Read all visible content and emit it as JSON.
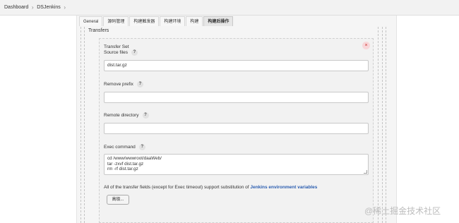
{
  "breadcrumb": {
    "items": [
      "Dashboard",
      "DSJenkins"
    ],
    "separator": "›"
  },
  "tabs": [
    {
      "label": "General",
      "active": false
    },
    {
      "label": "源码管理",
      "active": false
    },
    {
      "label": "构建触发器",
      "active": false
    },
    {
      "label": "构建环境",
      "active": false
    },
    {
      "label": "构建",
      "active": false
    },
    {
      "label": "构建后操作",
      "active": true
    }
  ],
  "transfers": {
    "label": "Transfers",
    "set_title": "Transfer Set",
    "close_symbol": "×"
  },
  "fields": {
    "source_files": {
      "label": "Source files",
      "value": "dist.tar.gz"
    },
    "remove_prefix": {
      "label": "Remove prefix",
      "value": ""
    },
    "remote_directory": {
      "label": "Remote directory",
      "value": ""
    },
    "exec_command": {
      "label": "Exec command",
      "lines": [
        "cd /www/wwwroot/daaWeb/",
        "tar -zxvf dist.tar.gz",
        "rm -rf dist.tar.gz"
      ]
    }
  },
  "help_symbol": "?",
  "note": {
    "text": "All of the transfer fields (except for Exec timeout) support substitution of ",
    "link": "Jenkins environment variables"
  },
  "advanced_button": "高级...",
  "watermark": "@稀土掘金技术社区",
  "colors": {
    "link": "#2a5db0",
    "close": "#c9302c",
    "close_bg": "#f8d7da"
  }
}
